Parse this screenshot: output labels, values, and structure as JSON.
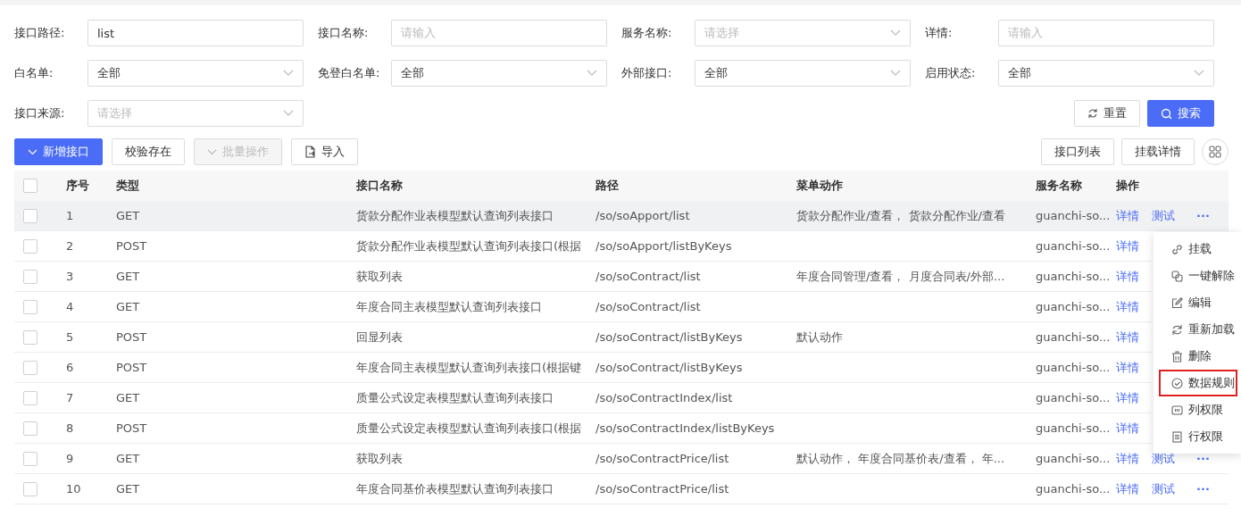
{
  "filters": [
    {
      "label": "接口路径:",
      "kind": "input",
      "value": "list"
    },
    {
      "label": "接口名称:",
      "kind": "input",
      "placeholder": "请输入"
    },
    {
      "label": "服务名称:",
      "kind": "select",
      "placeholder": "请选择"
    },
    {
      "label": "详情:",
      "kind": "input",
      "placeholder": "请输入"
    },
    {
      "label": "白名单:",
      "kind": "select",
      "value": "全部"
    },
    {
      "label": "免登白名单:",
      "kind": "select",
      "value": "全部"
    },
    {
      "label": "外部接口:",
      "kind": "select",
      "value": "全部"
    },
    {
      "label": "启用状态:",
      "kind": "select",
      "value": "全部"
    },
    {
      "label": "接口来源:",
      "kind": "select",
      "placeholder": "请选择"
    }
  ],
  "reset_button": "重置",
  "search_button": "搜索",
  "toolbar_left": [
    {
      "label": "新增接口",
      "kind": "primary",
      "disabled": false
    },
    {
      "label": "校验存在",
      "kind": "plain",
      "disabled": false
    },
    {
      "label": "批量操作",
      "kind": "dropdown",
      "disabled": true
    },
    {
      "label": "导入",
      "kind": "import",
      "disabled": false
    }
  ],
  "toolbar_right": [
    "接口列表",
    "挂载详情"
  ],
  "table": {
    "all_checked": false,
    "columns": [
      "序号",
      "类型",
      "接口名称",
      "路径",
      "菜单动作",
      "服务名称",
      "操作"
    ],
    "rows": [
      {
        "checked": false,
        "hovered": true,
        "cells": [
          "1",
          "GET",
          "货款分配作业表模型默认查询列表接口",
          "/so/soApport/list",
          "货款分配作业/查看， 货款分配作业/查看",
          "guanchi-so..."
        ],
        "actions": [
          "详情",
          "测试",
          "···"
        ]
      },
      {
        "checked": false,
        "hovered": false,
        "cells": [
          "2",
          "POST",
          "货款分配作业表模型默认查询列表接口(根据",
          "/so/soApport/listByKeys",
          "",
          "guanchi-so..."
        ],
        "actions": [
          "详情"
        ]
      },
      {
        "checked": false,
        "hovered": false,
        "cells": [
          "3",
          "GET",
          "获取列表",
          "/so/soContract/list",
          "年度合同管理/查看， 月度合同表/外部...",
          "guanchi-so..."
        ],
        "actions": [
          "详情"
        ]
      },
      {
        "checked": false,
        "hovered": false,
        "cells": [
          "4",
          "GET",
          "年度合同主表模型默认查询列表接口",
          "/so/soContract/list",
          "",
          "guanchi-so..."
        ],
        "actions": [
          "详情"
        ]
      },
      {
        "checked": false,
        "hovered": false,
        "cells": [
          "5",
          "POST",
          "回显列表",
          "/so/soContract/listByKeys",
          "默认动作",
          "guanchi-so..."
        ],
        "actions": [
          "详情"
        ]
      },
      {
        "checked": false,
        "hovered": false,
        "cells": [
          "6",
          "POST",
          "年度合同主表模型默认查询列表接口(根据键",
          "/so/soContract/listByKeys",
          "",
          "guanchi-so..."
        ],
        "actions": [
          "详情"
        ]
      },
      {
        "checked": false,
        "hovered": false,
        "cells": [
          "7",
          "GET",
          "质量公式设定表模型默认查询列表接口",
          "/so/soContractIndex/list",
          "",
          "guanchi-so..."
        ],
        "actions": [
          "详情"
        ]
      },
      {
        "checked": false,
        "hovered": false,
        "cells": [
          "8",
          "POST",
          "质量公式设定表模型默认查询列表接口(根据",
          "/so/soContractIndex/listByKeys",
          "",
          "guanchi-so..."
        ],
        "actions": [
          "详情"
        ]
      },
      {
        "checked": false,
        "hovered": false,
        "cells": [
          "9",
          "GET",
          "获取列表",
          "/so/soContractPrice/list",
          "默认动作， 年度合同基价表/查看， 年...",
          "guanchi-so..."
        ],
        "actions": [
          "详情",
          "测试",
          "···"
        ]
      },
      {
        "checked": false,
        "hovered": false,
        "cells": [
          "10",
          "GET",
          "年度合同基价表模型默认查询列表接口",
          "/so/soContractPrice/list",
          "",
          "guanchi-so..."
        ],
        "actions": [
          "详情",
          "测试",
          "···"
        ]
      }
    ]
  },
  "dropdown_menu": [
    {
      "label": "挂载",
      "kind": "link",
      "highlighted": false
    },
    {
      "label": "一键解除",
      "kind": "copy",
      "highlighted": false
    },
    {
      "label": "编辑",
      "kind": "edit",
      "highlighted": false
    },
    {
      "label": "重新加载",
      "kind": "reload",
      "highlighted": false
    },
    {
      "label": "删除",
      "kind": "delete",
      "highlighted": false
    },
    {
      "label": "数据规则",
      "kind": "check",
      "highlighted": true
    },
    {
      "label": "列权限",
      "kind": "columns",
      "highlighted": false
    },
    {
      "label": "行权限",
      "kind": "rows",
      "highlighted": false
    }
  ]
}
